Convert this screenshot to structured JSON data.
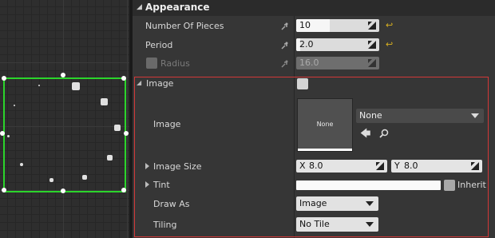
{
  "category": {
    "title": "Appearance"
  },
  "properties": {
    "number_of_pieces": {
      "label": "Number Of Pieces",
      "value": "10",
      "slider_fraction": 0.4
    },
    "period": {
      "label": "Period",
      "value": "2.0",
      "slider_fraction": 0.05
    },
    "radius": {
      "label": "Radius",
      "value": "16.0",
      "enabled": false
    }
  },
  "image_section": {
    "header": "Image",
    "image_label": "Image",
    "thumbnail_text": "None",
    "asset_dropdown": "None",
    "image_size_label": "Image Size",
    "size_x_prefix": "X",
    "size_x": "8.0",
    "size_y_prefix": "Y",
    "size_y": "8.0",
    "tint_label": "Tint",
    "inherit_label": "Inherit",
    "draw_as_label": "Draw As",
    "draw_as_value": "Image",
    "tiling_label": "Tiling",
    "tiling_value": "No Tile"
  },
  "colors": {
    "selection": "#2bd42b",
    "section_border": "#d23838",
    "reset_arrow": "#d8b020"
  },
  "icons": [
    "expand-arrow-icon",
    "keyframe-icon",
    "reset-to-default-icon",
    "use-selected-arrow-icon",
    "browse-search-icon",
    "grip-icon"
  ]
}
